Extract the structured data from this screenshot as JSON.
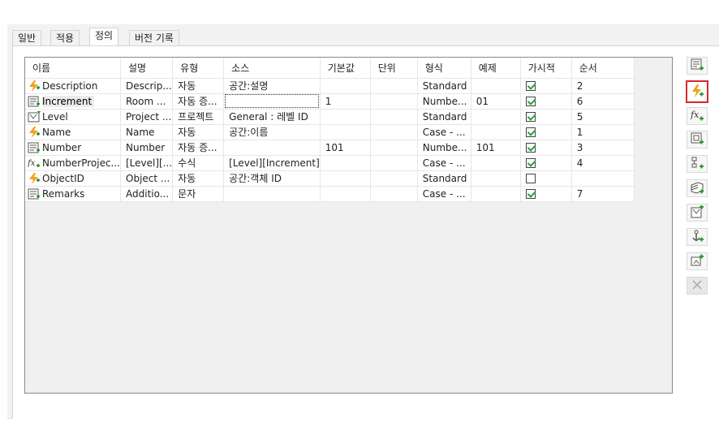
{
  "tabs": [
    "일반",
    "적용",
    "정의",
    "버전 기록"
  ],
  "active_tab": "정의",
  "columns": [
    "이름",
    "설명",
    "유형",
    "소스",
    "기본값",
    "단위",
    "형식",
    "예제",
    "가시적",
    "순서"
  ],
  "rows": [
    {
      "icon": "lightning-icon",
      "name": "Description",
      "desc": "Descrip...",
      "type": "자동",
      "source": "공간:설명",
      "default": "",
      "unit": "",
      "format": "Standard",
      "example": "",
      "visible": true,
      "order": "2"
    },
    {
      "icon": "list-icon",
      "name": "Increment",
      "desc": "Room ...",
      "type": "자동 증...",
      "source": "",
      "default": "1",
      "unit": "",
      "format": "Numbe...",
      "example": "01",
      "visible": true,
      "order": "6",
      "selected": true
    },
    {
      "icon": "level-icon",
      "name": "Level",
      "desc": "Project ...",
      "type": "프로젝트",
      "source": "General : 레벨 ID",
      "default": "",
      "unit": "",
      "format": "Standard",
      "example": "",
      "visible": true,
      "order": "5"
    },
    {
      "icon": "lightning-icon",
      "name": "Name",
      "desc": "Name",
      "type": "자동",
      "source": "공간:이름",
      "default": "",
      "unit": "",
      "format": "Case - ...",
      "example": "",
      "visible": true,
      "order": "1"
    },
    {
      "icon": "list-icon",
      "name": "Number",
      "desc": "Number",
      "type": "자동 증...",
      "source": "",
      "default": "101",
      "unit": "",
      "format": "Numbe...",
      "example": "101",
      "visible": true,
      "order": "3"
    },
    {
      "icon": "formula-icon",
      "name": "NumberProjec...",
      "desc": "[Level][...",
      "type": "수식",
      "source": "[Level][Increment]",
      "default": "",
      "unit": "",
      "format": "Case - ...",
      "example": "",
      "visible": true,
      "order": "4"
    },
    {
      "icon": "lightning-icon",
      "name": "ObjectID",
      "desc": "Object ...",
      "type": "자동",
      "source": "공간:객체 ID",
      "default": "",
      "unit": "",
      "format": "Standard",
      "example": "",
      "visible": false,
      "order": ""
    },
    {
      "icon": "list-icon",
      "name": "Remarks",
      "desc": "Additio...",
      "type": "문자",
      "source": "",
      "default": "",
      "unit": "",
      "format": "Case - ...",
      "example": "",
      "visible": true,
      "order": "7"
    }
  ],
  "toolbar": [
    {
      "icon": "add-list-icon",
      "tooltip": ""
    },
    {
      "icon": "add-automatic-icon",
      "highlighted": true
    },
    {
      "icon": "add-formula-icon"
    },
    {
      "icon": "add-object-icon"
    },
    {
      "icon": "add-hierarchy-icon"
    },
    {
      "icon": "add-stack-icon"
    },
    {
      "icon": "add-level-icon"
    },
    {
      "icon": "add-anchor-icon"
    },
    {
      "icon": "add-graphic-icon"
    },
    {
      "icon": "delete-icon",
      "disabled": true
    }
  ],
  "colors": {
    "accent_red": "#d9272e",
    "lightning": "#f0a020",
    "check_green": "#2f9c3a"
  }
}
